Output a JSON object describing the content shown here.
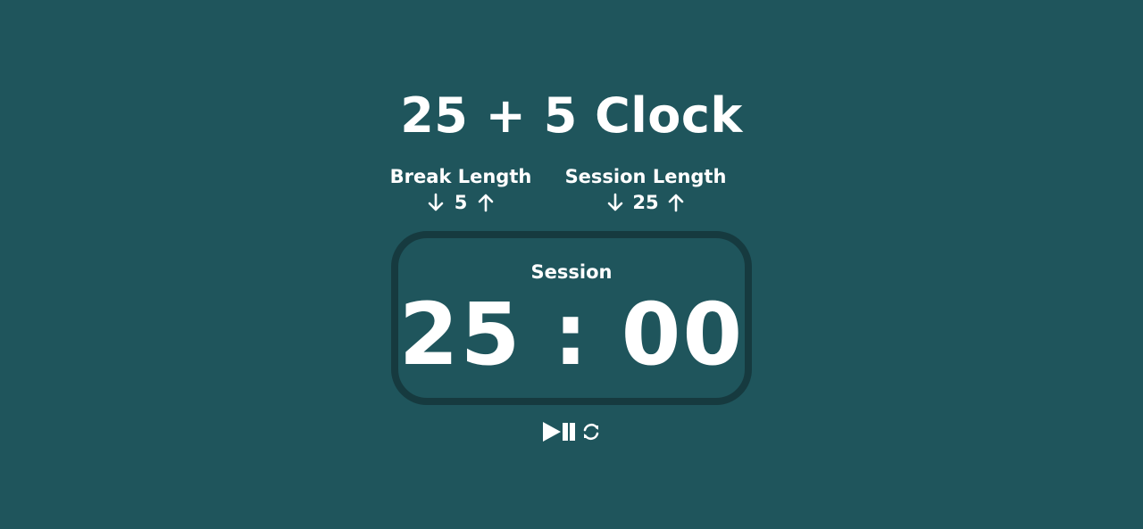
{
  "title": "25 + 5 Clock",
  "break": {
    "label": "Break Length",
    "value": "5",
    "decrement_icon": "arrow-down-icon",
    "increment_icon": "arrow-up-icon"
  },
  "session": {
    "label": "Session Length",
    "value": "25",
    "decrement_icon": "arrow-down-icon",
    "increment_icon": "arrow-up-icon"
  },
  "timer": {
    "label": "Session",
    "time_left": "25 : 00"
  },
  "controls": {
    "play_pause_icon": "play-pause-icon",
    "reset_icon": "refresh-icon"
  },
  "colors": {
    "background": "#1f555c",
    "timer_border": "#163a3f",
    "text": "#ffffff"
  }
}
